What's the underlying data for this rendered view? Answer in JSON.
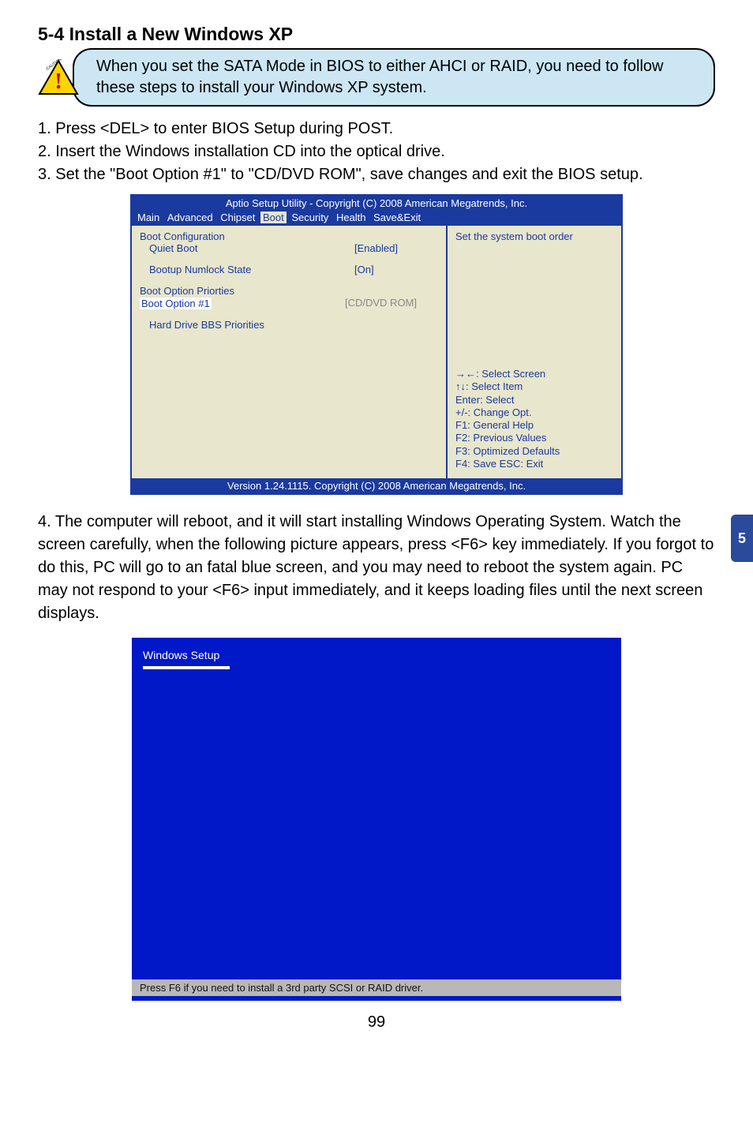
{
  "section_title": "5-4 Install a New Windows XP",
  "caution_text": "When you set the SATA Mode in BIOS to either AHCI or RAID, you need to follow these steps to install your Windows XP system.",
  "steps": [
    "1. Press <DEL> to enter BIOS Setup during POST.",
    "2. Insert the Windows installation CD into the optical drive.",
    "3. Set the \"Boot Option #1\" to \"CD/DVD ROM\", save changes and exit the BIOS setup."
  ],
  "bios": {
    "header": "Aptio Setup Utility - Copyright (C) 2008 American Megatrends, Inc.",
    "menu": [
      "Main",
      "Advanced",
      "Chipset",
      "Boot",
      "Security",
      "Health",
      "Save&Exit"
    ],
    "menu_selected_index": 3,
    "left": {
      "heading1": "Boot Configuration",
      "row1_label": "Quiet Boot",
      "row1_value": "[Enabled]",
      "row2_label": "Bootup Numlock State",
      "row2_value": "[On]",
      "heading2": "Boot Option Priorties",
      "sel_label": "Boot Option #1",
      "sel_value": "[CD/DVD ROM]",
      "row3_label": "Hard Drive BBS Priorities"
    },
    "right": {
      "top_text": "Set the system boot order",
      "help": [
        "→←: Select Screen",
        "↑↓: Select Item",
        "Enter: Select",
        "+/-: Change Opt.",
        "F1:  General Help",
        "F2:  Previous Values",
        "F3: Optimized Defaults",
        "F4: Save  ESC: Exit"
      ]
    },
    "footer": "Version 1.24.1115. Copyright (C) 2008 American Megatrends, Inc."
  },
  "body_text": "4. The computer will reboot, and it will start installing Windows Operating System. Watch the screen carefully, when the following picture appears, press <F6> key immediately. If you forgot to do this, PC will go to an fatal blue screen, and you may need to reboot the system again. PC may not respond to your <F6> input immediately, and it keeps loading files until the next screen displays.",
  "windows_setup": {
    "title": "Windows Setup",
    "status": "Press F6 if you need to install a 3rd party SCSI or RAID driver."
  },
  "side_tab": "5",
  "page_number": "99"
}
